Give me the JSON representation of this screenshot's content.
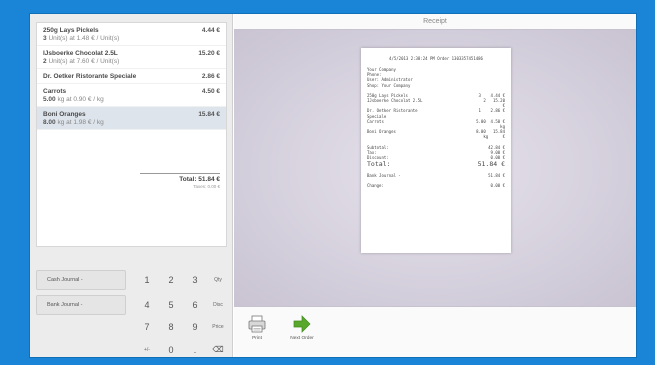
{
  "order": {
    "lines": [
      {
        "name": "250g Lays Pickels",
        "qty": "3",
        "info": "Unit(s) at 1.48 € / Unit(s)",
        "price": "4.44 €"
      },
      {
        "name": "IJsboerke Chocolat 2.5L",
        "qty": "2",
        "info": "Unit(s) at 7.60 € / Unit(s)",
        "price": "15.20 €"
      },
      {
        "name": "Dr. Oetker Ristorante Speciale",
        "qty": "",
        "info": "",
        "price": "2.86 €"
      },
      {
        "name": "Carrots",
        "qty": "5.00",
        "info": "kg at 0.90 € / kg",
        "price": "4.50 €"
      },
      {
        "name": "Boni Oranges",
        "qty": "8.00",
        "info": "kg at 1.98 € / kg",
        "price": "15.84 €"
      }
    ],
    "total": "Total: 51.84 €",
    "taxes": "Taxes: 0.00 €"
  },
  "pad": {
    "cash_journal": "Cash Journal -",
    "bank_journal": "Bank Journal -",
    "keys": [
      "1",
      "2",
      "3",
      "4",
      "5",
      "6",
      "7",
      "8",
      "9",
      "+/-",
      "0",
      "."
    ],
    "modes": [
      "Qty",
      "Disc",
      "Price"
    ],
    "backspace": "⌫"
  },
  "receipt": {
    "title": "Receipt",
    "header": "4/5/2013 2:38:24 PM Order 1303357451486",
    "company": [
      "Your Company",
      "Phone:",
      "User: Administrator",
      "Shop: Your Company"
    ],
    "lines": [
      {
        "l": "250g Lays Pickels",
        "r": "3    4.44 €"
      },
      {
        "l": "IJsboerke Chocolat 2.5L",
        "r": "2   15.20"
      },
      {
        "l": "",
        "r": "€"
      },
      {
        "l": "Dr. Oetker Ristorante",
        "r": "1    2.86 €"
      },
      {
        "l": "Speciale",
        "r": ""
      },
      {
        "l": "Carrots",
        "r": "5.00  4.50 €"
      },
      {
        "l": "",
        "r": "kg"
      },
      {
        "l": "Boni Oranges",
        "r": "8.00   15.84"
      },
      {
        "l": "",
        "r": "kg      €"
      }
    ],
    "subtotal": {
      "l": "Subtotal:",
      "r": "42.84 €"
    },
    "tax": {
      "l": "Tax:",
      "r": "9.00 €"
    },
    "discount": {
      "l": "Discount:",
      "r": "0.00 €"
    },
    "total": {
      "l": "Total:",
      "r": "51.84 €"
    },
    "bank": {
      "l": "Bank Journal -",
      "r": "51.84 €"
    },
    "change": {
      "l": "Change:",
      "r": "0.00 €"
    }
  },
  "actions": {
    "print": "Print",
    "next_order": "Next Order"
  },
  "colors": {
    "screen_bg": "#1a84d6",
    "next_arrow": "#5aa72e"
  }
}
